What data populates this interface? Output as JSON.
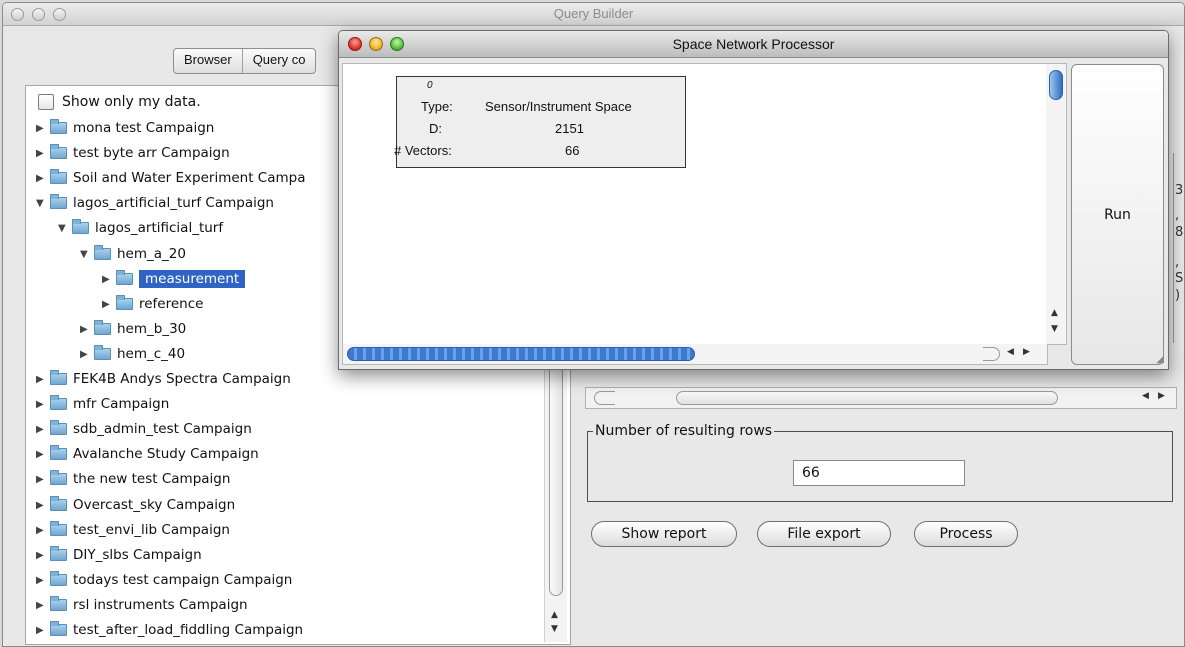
{
  "query_builder": {
    "title": "Query Builder",
    "tabs": [
      "Browser",
      "Query co"
    ],
    "show_only_label": "Show only my data.",
    "show_only_checked": false,
    "tree": [
      {
        "label": "mona test Campaign",
        "level": 0,
        "expanded": false
      },
      {
        "label": "test byte arr Campaign",
        "level": 0,
        "expanded": false
      },
      {
        "label": "Soil and Water Experiment Campa",
        "level": 0,
        "expanded": false
      },
      {
        "label": "lagos_artificial_turf Campaign",
        "level": 0,
        "expanded": true
      },
      {
        "label": "lagos_artificial_turf",
        "level": 1,
        "expanded": true
      },
      {
        "label": "hem_a_20",
        "level": 2,
        "expanded": true
      },
      {
        "label": "measurement",
        "level": 3,
        "expanded": false,
        "selected": true
      },
      {
        "label": "reference",
        "level": 3,
        "expanded": false
      },
      {
        "label": "hem_b_30",
        "level": 2,
        "expanded": false
      },
      {
        "label": "hem_c_40",
        "level": 2,
        "expanded": false
      },
      {
        "label": "FEK4B Andys Spectra Campaign",
        "level": 0,
        "expanded": false
      },
      {
        "label": "mfr Campaign",
        "level": 0,
        "expanded": false
      },
      {
        "label": "sdb_admin_test Campaign",
        "level": 0,
        "expanded": false
      },
      {
        "label": "Avalanche Study Campaign",
        "level": 0,
        "expanded": false
      },
      {
        "label": "the new test  Campaign",
        "level": 0,
        "expanded": false
      },
      {
        "label": "Overcast_sky Campaign",
        "level": 0,
        "expanded": false
      },
      {
        "label": "test_envi_lib Campaign",
        "level": 0,
        "expanded": false
      },
      {
        "label": "DIY_slbs Campaign",
        "level": 0,
        "expanded": false
      },
      {
        "label": "todays test campaign Campaign",
        "level": 0,
        "expanded": false
      },
      {
        "label": "rsl instruments Campaign",
        "level": 0,
        "expanded": false
      },
      {
        "label": "test_after_load_fiddling Campaign",
        "level": 0,
        "expanded": false
      }
    ],
    "right_edge_glyphs": [
      "3",
      ",",
      "8",
      ",",
      "S",
      ")"
    ],
    "rows_group_label": "Number of resulting rows",
    "rows_value": "66",
    "buttons": {
      "show_report": "Show report",
      "file_export": "File export",
      "process": "Process"
    }
  },
  "space_network_processor": {
    "title": "Space Network Processor",
    "node": {
      "id": "0",
      "type_label": "Type:",
      "type_value": "Sensor/Instrument Space",
      "d_label": "D:",
      "d_value": "2151",
      "vectors_label": "# Vectors:",
      "vectors_value": "66"
    },
    "run_label": "Run"
  },
  "colors": {
    "selection": "#2f64c5",
    "close": "#e0362c",
    "minimize": "#f2b42b",
    "zoom": "#56c13e",
    "scroll_thumb_active": "#2e6fbf"
  }
}
